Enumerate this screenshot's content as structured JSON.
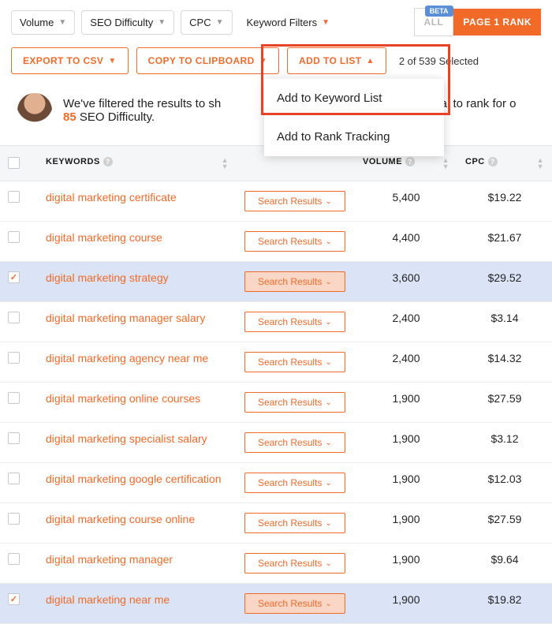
{
  "filters": {
    "volume": "Volume",
    "seo_difficulty": "SEO Difficulty",
    "cpc": "CPC",
    "keyword_filters": "Keyword Filters"
  },
  "tabs": {
    "beta": "BETA",
    "all": "ALL",
    "rank": "PAGE 1 RANK"
  },
  "actions": {
    "export": "EXPORT TO CSV",
    "copy": "COPY TO CLIPBOARD",
    "add_to_list": "ADD TO LIST",
    "selected_text": "2 of 539 Selected"
  },
  "add_menu": {
    "keyword_list": "Add to Keyword List",
    "rank_tracking": "Add to Rank Tracking"
  },
  "info": {
    "line1_a": "We've filtered the results to sh",
    "line1_b": "as the potential to rank for o",
    "bold_num": "85",
    "line2": " SEO Difficulty."
  },
  "columns": {
    "keywords": "KEYWORDS",
    "volume": "VOLUME",
    "cpc": "CPC"
  },
  "search_results_label": "Search Results",
  "rows": [
    {
      "selected": false,
      "keyword": "digital marketing certificate",
      "volume": "5,400",
      "cpc": "$19.22"
    },
    {
      "selected": false,
      "keyword": "digital marketing course",
      "volume": "4,400",
      "cpc": "$21.67"
    },
    {
      "selected": true,
      "keyword": "digital marketing strategy",
      "volume": "3,600",
      "cpc": "$29.52"
    },
    {
      "selected": false,
      "keyword": "digital marketing manager salary",
      "volume": "2,400",
      "cpc": "$3.14"
    },
    {
      "selected": false,
      "keyword": "digital marketing agency near me",
      "volume": "2,400",
      "cpc": "$14.32"
    },
    {
      "selected": false,
      "keyword": "digital marketing online courses",
      "volume": "1,900",
      "cpc": "$27.59"
    },
    {
      "selected": false,
      "keyword": "digital marketing specialist salary",
      "volume": "1,900",
      "cpc": "$3.12"
    },
    {
      "selected": false,
      "keyword": "digital marketing google certification",
      "volume": "1,900",
      "cpc": "$12.03"
    },
    {
      "selected": false,
      "keyword": "digital marketing course online",
      "volume": "1,900",
      "cpc": "$27.59"
    },
    {
      "selected": false,
      "keyword": "digital marketing manager",
      "volume": "1,900",
      "cpc": "$9.64"
    },
    {
      "selected": true,
      "keyword": "digital marketing near me",
      "volume": "1,900",
      "cpc": "$19.82"
    }
  ]
}
